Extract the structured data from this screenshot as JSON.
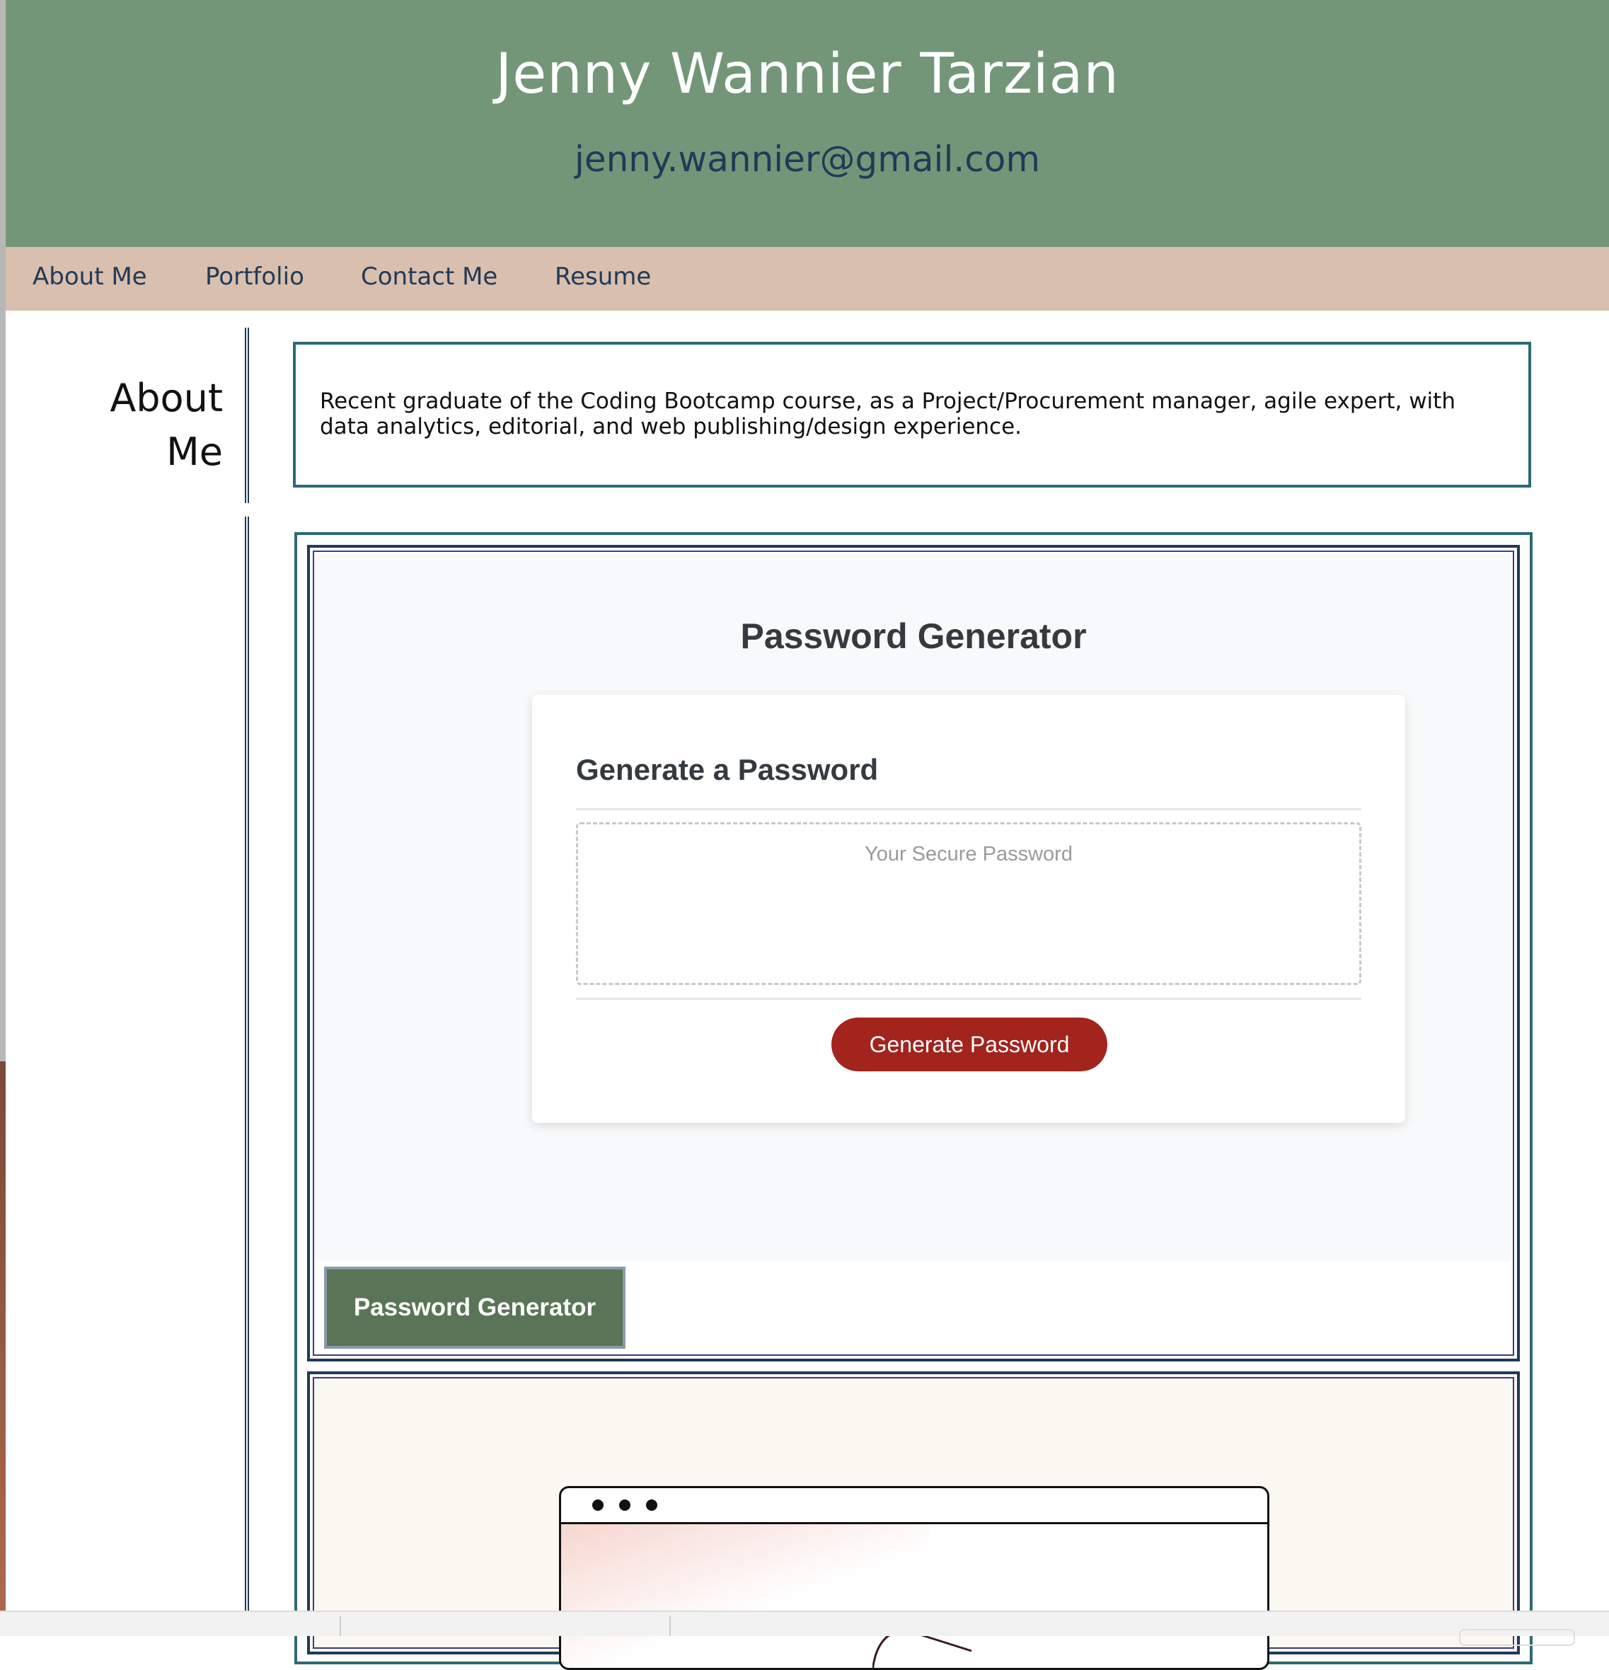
{
  "header": {
    "name": "Jenny Wannier Tarzian",
    "email": "jenny.wannier@gmail.com"
  },
  "nav": {
    "items": [
      {
        "label": "About Me"
      },
      {
        "label": "Portfolio"
      },
      {
        "label": "Contact Me"
      },
      {
        "label": "Resume"
      }
    ]
  },
  "about": {
    "heading": "About Me",
    "text": "Recent graduate of the Coding Bootcamp course, as a Project/Procurement manager, agile expert, with data analytics, editorial, and web publishing/design experience."
  },
  "portfolio": {
    "project1": {
      "screenshot": {
        "title": "Password Generator",
        "card_heading": "Generate a Password",
        "placeholder": "Your Secure Password",
        "button_label": "Generate Password"
      },
      "label": "Password Generator"
    }
  },
  "colors": {
    "header_bg": "#739679",
    "nav_bg": "#d9bfad",
    "link_color": "#213a57",
    "border_teal": "#2d6a73",
    "generate_button": "#a3231d",
    "project_label_bg": "#5a7458"
  }
}
